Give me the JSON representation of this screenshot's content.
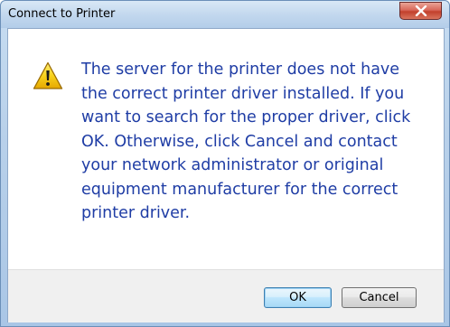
{
  "window": {
    "title": "Connect to Printer",
    "close_icon": "close-icon"
  },
  "dialog": {
    "icon": "warning-icon",
    "message": "The server for the printer does not have\nthe correct printer driver installed.  If you\nwant to search for the proper driver, click\nOK.  Otherwise, click Cancel and contact\nyour network administrator or original\nequipment manufacturer for the correct\nprinter driver."
  },
  "buttons": {
    "ok_label": "OK",
    "cancel_label": "Cancel"
  },
  "colors": {
    "message_text": "#1f3da5",
    "close_button": "#c2402c",
    "warning_yellow": "#f5c400"
  }
}
